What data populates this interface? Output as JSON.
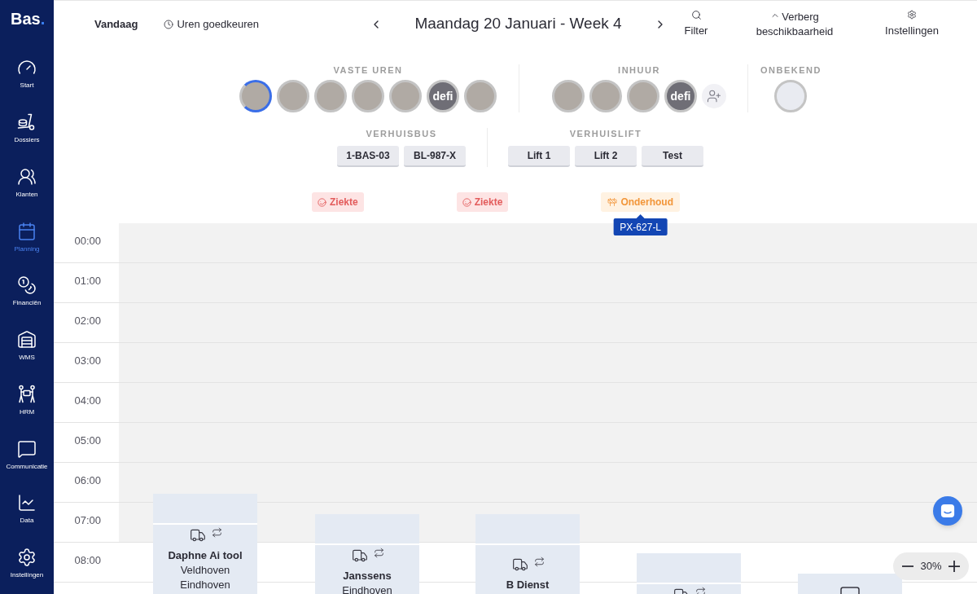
{
  "sidebar": {
    "logo": {
      "name": "Bas",
      "mark": "."
    },
    "items": [
      {
        "label": "Start",
        "selected": false
      },
      {
        "label": "Dossiers",
        "selected": false
      },
      {
        "label": "Klanten",
        "selected": false
      },
      {
        "label": "Planning",
        "selected": true
      },
      {
        "label": "Financiën",
        "selected": false
      },
      {
        "label": "WMS",
        "selected": false
      },
      {
        "label": "HRM",
        "selected": false
      },
      {
        "label": "Communicatie",
        "selected": false
      },
      {
        "label": "Data",
        "selected": false
      },
      {
        "label": "Instellingen",
        "selected": false
      }
    ]
  },
  "toolbar": {
    "today": "Vandaag",
    "approve_hours": "Uren goedkeuren",
    "title": "Maandag 20 Januari - Week 4",
    "actions": [
      {
        "kind": "filter",
        "label": "Filter"
      },
      {
        "kind": "hide",
        "label": "Verberg beschikbaarheid"
      },
      {
        "kind": "settings",
        "label": "Instellingen"
      }
    ]
  },
  "staff_groups": [
    {
      "title": "VASTE UREN",
      "avatars": [
        {
          "kind": "photo",
          "selected": true
        },
        {
          "kind": "photo",
          "selected": false
        },
        {
          "kind": "photo",
          "selected": false
        },
        {
          "kind": "photo",
          "selected": false
        },
        {
          "kind": "photo",
          "selected": false
        },
        {
          "kind": "logo",
          "text": "defi",
          "selected": false
        },
        {
          "kind": "photo",
          "selected": false
        }
      ]
    },
    {
      "title": "INHUUR",
      "avatars": [
        {
          "kind": "photo",
          "selected": false
        },
        {
          "kind": "photo",
          "selected": false
        },
        {
          "kind": "photo",
          "selected": false
        },
        {
          "kind": "logo",
          "text": "defi",
          "selected": false
        },
        {
          "kind": "add",
          "selected": false
        }
      ]
    },
    {
      "title": "ONBEKEND",
      "avatars": [
        {
          "kind": "scan",
          "selected": false
        }
      ]
    }
  ],
  "vehicle_groups": [
    {
      "title": "VERHUISBUS",
      "items": [
        {
          "label": "1-BAS-03",
          "selected": false
        },
        {
          "label": "BL-987-X",
          "selected": false
        }
      ]
    },
    {
      "title": "VERHUISLIFT",
      "items": [
        {
          "label": "Lift 1",
          "selected": false
        },
        {
          "label": "Lift 2",
          "selected": false
        },
        {
          "label": "Test",
          "selected": false
        }
      ]
    }
  ],
  "absences": [
    {
      "kind": "sick",
      "label": "Ziekte"
    },
    {
      "kind": "sick",
      "label": "Ziekte"
    },
    {
      "kind": "maintenance",
      "label": "Onderhoud",
      "tooltip": "PX-627-L"
    }
  ],
  "calendar": {
    "rows": [
      {
        "time": "00:00",
        "available": false
      },
      {
        "time": "01:00",
        "available": false
      },
      {
        "time": "02:00",
        "available": false
      },
      {
        "time": "03:00",
        "available": false
      },
      {
        "time": "04:00",
        "available": false
      },
      {
        "time": "05:00",
        "available": false
      },
      {
        "time": "06:00",
        "available": false
      },
      {
        "time": "07:00",
        "available": false
      },
      {
        "time": "08:00",
        "available": true
      }
    ],
    "events": [
      {
        "kind": "transport",
        "name": "Daphne Ai tool",
        "lines": [
          "Veldhoven",
          "Eindhoven"
        ]
      },
      {
        "kind": "transport",
        "name": "Janssens",
        "lines": [
          "Eindhoven"
        ]
      },
      {
        "kind": "transport",
        "name": "B Dienst"
      },
      {
        "kind": "transport"
      },
      {
        "kind": "storage"
      }
    ]
  },
  "zoom": {
    "value": "30%"
  }
}
